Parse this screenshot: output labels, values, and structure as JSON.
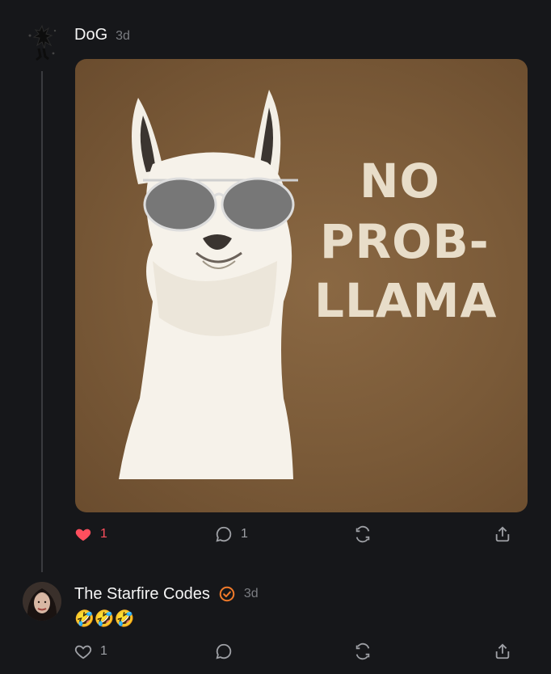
{
  "post1": {
    "username": "DoG",
    "time": "3d",
    "image": {
      "alt_text_lines": [
        "NO",
        "PROB-",
        "LLAMA"
      ]
    },
    "actions": {
      "like_count": "1",
      "reply_count": "1",
      "repost_count": "",
      "liked": true
    }
  },
  "post2": {
    "username": "The Starfire Codes",
    "time": "3d",
    "body": "🤣🤣🤣",
    "actions": {
      "like_count": "1",
      "reply_count": "",
      "repost_count": ""
    }
  },
  "colors": {
    "background": "#16171a",
    "like_active": "#ff4f5e",
    "verified": "#f07a2a",
    "muted": "#7b7d82"
  },
  "icons": [
    "heart-icon",
    "comment-icon",
    "repost-icon",
    "share-icon",
    "verified-badge-icon"
  ]
}
